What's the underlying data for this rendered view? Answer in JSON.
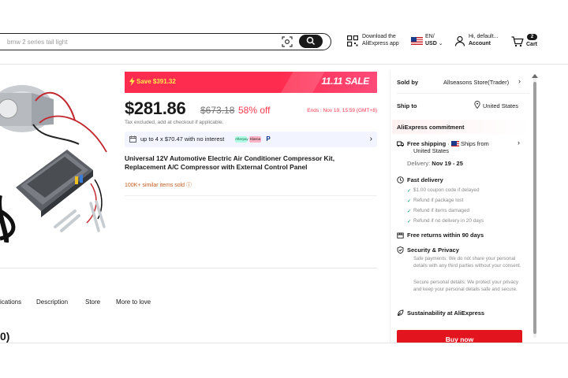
{
  "header": {
    "search_placeholder": "bmw 2 series tail light",
    "app_download": [
      "Download the",
      "AliExpress app"
    ],
    "lang": {
      "line1": "EN/",
      "currency": "USD"
    },
    "account": {
      "greeting": "Hi, default...",
      "label": "Account"
    },
    "cart": {
      "count": "2",
      "label": "Cart"
    }
  },
  "banner": {
    "save": "Save $391.32",
    "sale": "11.11 SALE"
  },
  "price": {
    "current": "$281.86",
    "original": "$673.18",
    "discount": "58% off",
    "ends": "Ends : Nov 19, 15:59 (GMT+8)",
    "tax_note": "Tax excluded, add at checkout if applicable."
  },
  "installment": {
    "text": "up to 4 x $70.47 with no interest",
    "providers": [
      "Afterpay",
      "Klarna",
      "P"
    ]
  },
  "product": {
    "title": "Universal 12V Automotive Electric Air Conditioner Compressor Kit, Replacement A/C Compressor with External Control Panel",
    "similar": "100K+ similar items sold ⓘ"
  },
  "tabs": [
    "ications",
    "Description",
    "Store",
    "More to love"
  ],
  "reviews_heading": "0)",
  "panel": {
    "sold_by_label": "Sold by",
    "sold_by_value": "Allseasons Store(Trader)",
    "ship_to_label": "Ship to",
    "ship_to_value": "United States",
    "commitment": "AliExpress commitment",
    "free_shipping": "Free shipping",
    "ships_from": "Ships from",
    "ships_from_country": "United States",
    "delivery_label": "Delivery:",
    "delivery_dates": "Nov 19 - 25",
    "fast_delivery": "Fast delivery",
    "fast_items": [
      "$1.00 coupon code if delayed",
      "Refund if package lost",
      "Refund if items damaged",
      "Refund if no delivery in 20 days"
    ],
    "free_returns": "Free returns within 90 days",
    "security": "Security & Privacy",
    "safe_payments": "Safe payments: We do not share your personal details with any third parties without your consent.",
    "secure_details": "Secure personal details: We protect your privacy and keep your personal details safe and secure.",
    "sustainability": "Sustainability at AliExpress",
    "buy_now": "Buy now"
  },
  "colors": {
    "accent_red": "#fe2d50",
    "buy_red": "#e2151e",
    "sale_yellow": "#ffe94d",
    "check_green": "#00a36d"
  }
}
